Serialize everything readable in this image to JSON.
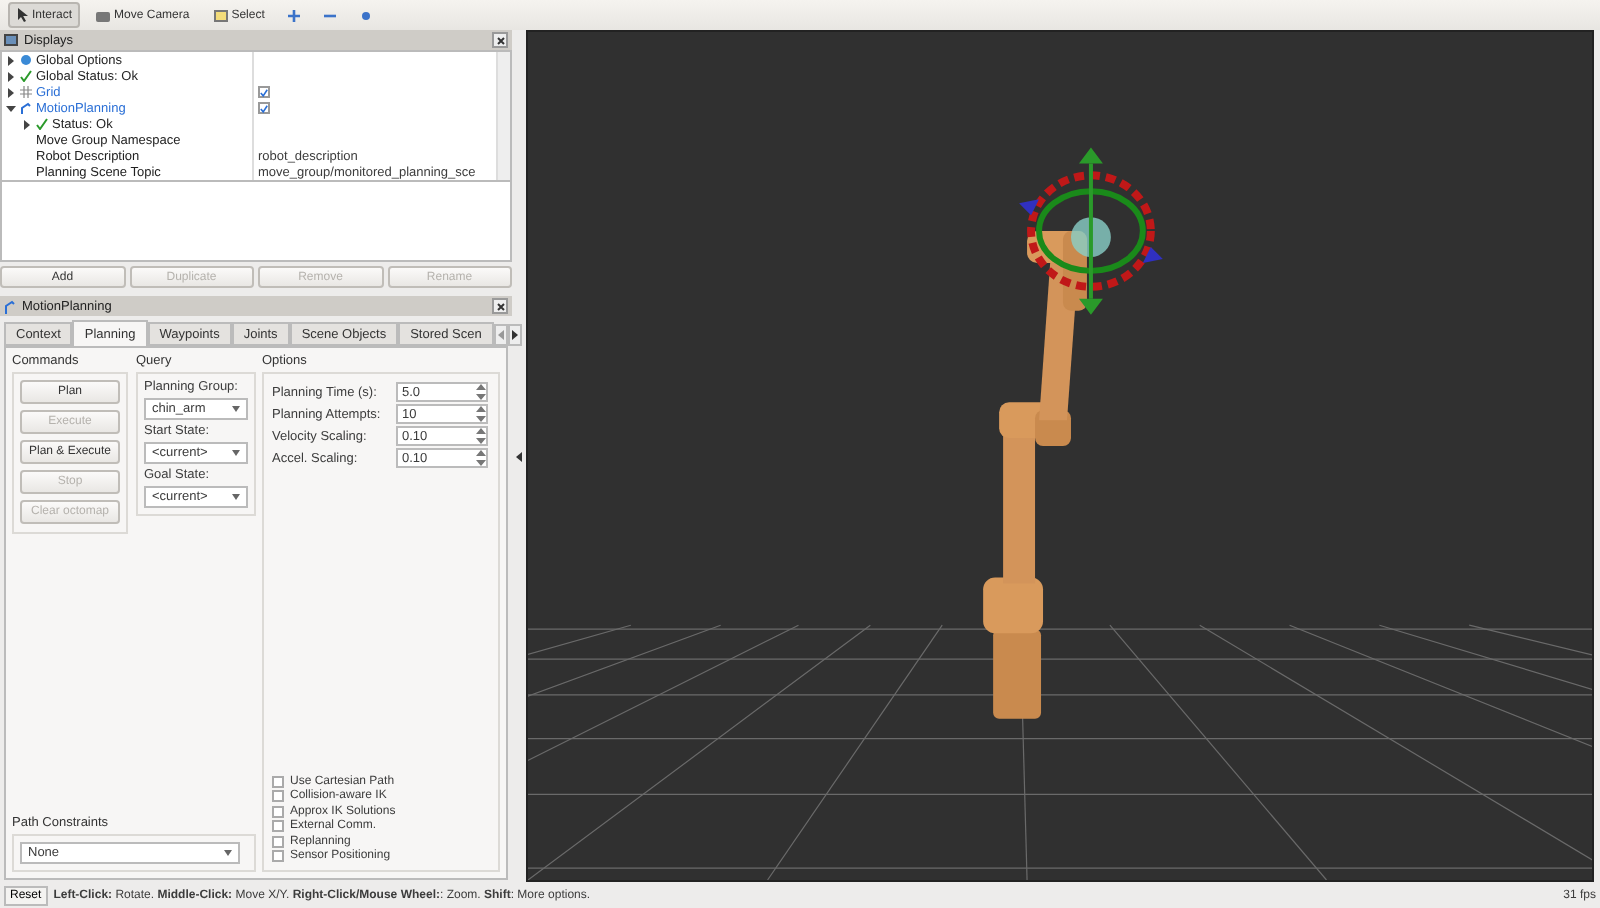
{
  "toolbar": [
    {
      "label": "Interact",
      "kind": "cursor",
      "selected": true
    },
    {
      "label": "Move Camera",
      "kind": "camera",
      "selected": false
    },
    {
      "label": "Select",
      "kind": "select",
      "selected": false
    },
    {
      "kind": "plus"
    },
    {
      "kind": "minus"
    },
    {
      "kind": "target"
    }
  ],
  "displays": {
    "title": "Displays",
    "tree": [
      {
        "label": "Global Options",
        "kind": "globe",
        "expanded": false
      },
      {
        "label": "Global Status: Ok",
        "kind": "check",
        "expanded": false
      },
      {
        "label": "Grid",
        "kind": "grid",
        "expanded": false,
        "checked": true
      },
      {
        "label": "MotionPlanning",
        "kind": "arm",
        "expanded": true,
        "checked": true,
        "children": [
          {
            "label": "Status: Ok",
            "kind": "check",
            "expanded": false
          },
          {
            "label": "Move Group Namespace"
          },
          {
            "label": "Robot Description",
            "value": "robot_description"
          },
          {
            "label": "Planning Scene Topic",
            "value": "move_group/monitored_planning_sce"
          }
        ]
      }
    ],
    "buttons": [
      {
        "label": "Add",
        "disabled": false
      },
      {
        "label": "Duplicate",
        "disabled": true
      },
      {
        "label": "Remove",
        "disabled": true
      },
      {
        "label": "Rename",
        "disabled": true
      }
    ]
  },
  "motion_planning": {
    "title": "MotionPlanning",
    "tabs": [
      {
        "label": "Context",
        "selected": false
      },
      {
        "label": "Planning",
        "selected": true
      },
      {
        "label": "Waypoints",
        "selected": false
      },
      {
        "label": "Joints",
        "selected": false
      },
      {
        "label": "Scene Objects",
        "selected": false
      },
      {
        "label": "Stored Scen",
        "selected": false
      }
    ],
    "commands": {
      "title": "Commands",
      "buttons": [
        {
          "label": "Plan",
          "disabled": false
        },
        {
          "label": "Execute",
          "disabled": true
        },
        {
          "label": "Plan & Execute",
          "disabled": false
        },
        {
          "label": "Stop",
          "disabled": true
        },
        {
          "label": "Clear octomap",
          "disabled": true
        }
      ]
    },
    "query": {
      "title": "Query",
      "fields": [
        {
          "label": "Planning Group:",
          "value": "chin_arm"
        },
        {
          "label": "Start State:",
          "value": "<current>"
        },
        {
          "label": "Goal State:",
          "value": "<current>"
        }
      ]
    },
    "options": {
      "title": "Options",
      "spinboxes": [
        {
          "label": "Planning Time (s):",
          "value": "5.0"
        },
        {
          "label": "Planning Attempts:",
          "value": "10"
        },
        {
          "label": "Velocity Scaling:",
          "value": "0.10"
        },
        {
          "label": "Accel. Scaling:",
          "value": "0.10"
        }
      ],
      "checkboxes": [
        {
          "label": "Use Cartesian Path",
          "checked": false
        },
        {
          "label": "Collision-aware IK",
          "checked": false
        },
        {
          "label": "Approx IK Solutions",
          "checked": false
        },
        {
          "label": "External Comm.",
          "checked": false
        },
        {
          "label": "Replanning",
          "checked": false
        },
        {
          "label": "Sensor Positioning",
          "checked": false
        }
      ]
    },
    "path_constraints": {
      "title": "Path Constraints",
      "value": "None"
    }
  },
  "status_bar": {
    "button": "Reset",
    "hint": "**Left-Click:** Rotate. **Middle-Click:** Move X/Y. **Right-Click/Mouse Wheel:**: Zoom. **Shift**: More options.",
    "fps": "31 fps"
  }
}
